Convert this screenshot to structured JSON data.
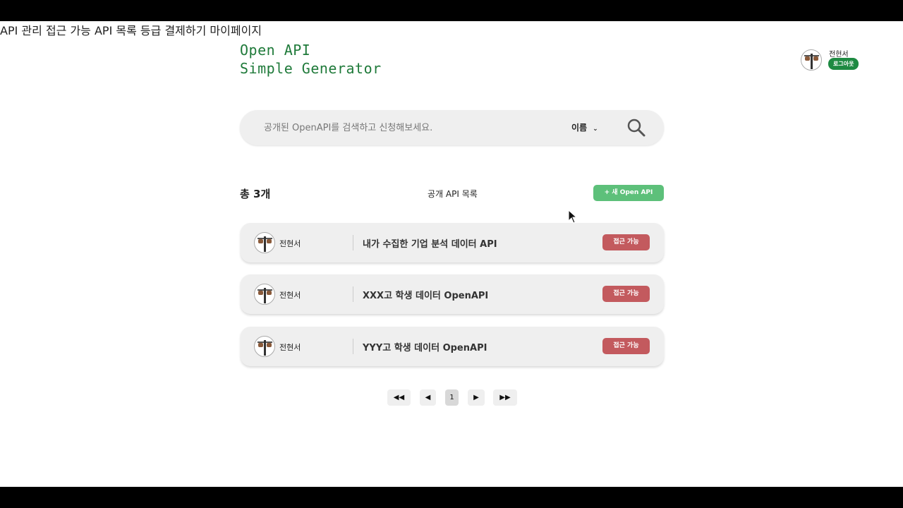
{
  "header": {
    "logo_line1": "Open API",
    "logo_line2": "Simple Generator",
    "nav": [
      {
        "label": "API 관리"
      },
      {
        "label": "접근 가능 API 목록"
      },
      {
        "label": "등급 결제하기"
      },
      {
        "label": "마이페이지"
      }
    ],
    "user": {
      "name": "전현서",
      "logout_label": "로그아웃"
    }
  },
  "search": {
    "placeholder": "공개된 OpenAPI를 검색하고 신청해보세요.",
    "filter_selected": "이름",
    "icons": {
      "search": "search-icon",
      "dropdown": "chevron-down-icon"
    }
  },
  "list": {
    "total_label": "총 3개",
    "title": "공개 API 목록",
    "new_button_label": "+ 새 Open API",
    "rows": [
      {
        "owner": "전현서",
        "name": "내가 수집한 기업 분석 데이터 API",
        "status": "접근 가능"
      },
      {
        "owner": "전현서",
        "name": "XXX고 학생 데이터 OpenAPI",
        "status": "접근 가능"
      },
      {
        "owner": "전현서",
        "name": "YYY고 학생 데이터 OpenAPI",
        "status": "접근 가능"
      }
    ]
  },
  "pagination": {
    "first": "◀◀",
    "prev": "◀",
    "current": "1",
    "next": "▶",
    "last": "▶▶"
  },
  "colors": {
    "brand_green": "#1f7a3a",
    "logout_green": "#1e8a42",
    "new_button_green": "#5dc07a",
    "access_red": "#c35a5e"
  }
}
